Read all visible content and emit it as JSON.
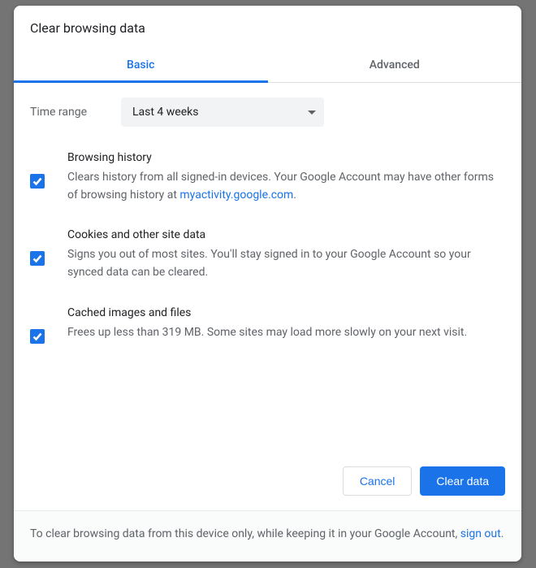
{
  "dialog": {
    "title": "Clear browsing data",
    "tabs": {
      "basic": "Basic",
      "advanced": "Advanced",
      "active": "basic"
    },
    "time_range": {
      "label": "Time range",
      "selected": "Last 4 weeks"
    },
    "options": [
      {
        "id": "browsing-history",
        "title": "Browsing history",
        "checked": true,
        "desc_pre": "Clears history from all signed-in devices. Your Google Account may have other forms of browsing history at ",
        "link_text": "myactivity.google.com",
        "desc_post": "."
      },
      {
        "id": "cookies",
        "title": "Cookies and other site data",
        "checked": true,
        "desc": "Signs you out of most sites. You'll stay signed in to your Google Account so your synced data can be cleared."
      },
      {
        "id": "cache",
        "title": "Cached images and files",
        "checked": true,
        "desc": "Frees up less than 319 MB. Some sites may load more slowly on your next visit."
      }
    ],
    "buttons": {
      "cancel": "Cancel",
      "clear": "Clear data"
    },
    "footer": {
      "pre": "To clear browsing data from this device only, while keeping it in your Google Account, ",
      "link": "sign out",
      "post": "."
    }
  }
}
